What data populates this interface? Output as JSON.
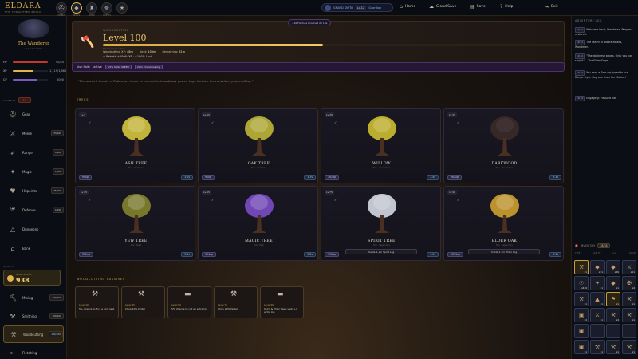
{
  "brand": {
    "logo": "ELDARA",
    "tagline": "THE FORGOTTEN REALM"
  },
  "topbar": {
    "icons": [
      {
        "label": "COMBAT",
        "icon": "helmet-icon"
      },
      {
        "label": "SKILLS",
        "icon": "gem-icon"
      },
      {
        "label": "SHOP",
        "icon": "castle-icon"
      },
      {
        "label": "QUESTS",
        "icon": "mask-icon"
      },
      {
        "label": "",
        "icon": "star-icon"
      }
    ],
    "grandsmith": {
      "name": "GRAND SMITH",
      "level": "Lv.12",
      "tier": "Guardian"
    },
    "nav": [
      {
        "label": "Home",
        "icon": "home-icon"
      },
      {
        "label": "Cloud Save",
        "icon": "cloud-icon"
      },
      {
        "label": "Save",
        "icon": "save-icon"
      },
      {
        "label": "Help",
        "icon": "help-icon"
      },
      {
        "label": "Exit",
        "icon": "exit-icon"
      }
    ]
  },
  "character": {
    "name": "The Wanderer",
    "title_tag": "Lv.14",
    "title": "Guardian",
    "stats": [
      {
        "key": "HP",
        "value": "40/40",
        "fill": 1.0,
        "color": "#c0392b"
      },
      {
        "key": "XP",
        "value": "1,119/1,860",
        "fill": 0.6,
        "color": "#e3b34c"
      },
      {
        "key": "CP",
        "value": "2000",
        "fill": 0.7,
        "color": "#7a5ac0"
      }
    ]
  },
  "combat": {
    "header": "COMBAT",
    "level": "13",
    "skills": [
      {
        "name": "Gear",
        "badge": "",
        "icon": "helmet-icon"
      },
      {
        "name": "Melee",
        "badge": "33/100",
        "icon": "swords-icon"
      },
      {
        "name": "Range",
        "badge": "1/100",
        "icon": "bow-icon"
      },
      {
        "name": "Magic",
        "badge": "1/100",
        "icon": "magic-icon"
      },
      {
        "name": "Hitpoints",
        "badge": "25/100",
        "icon": "heart-icon"
      },
      {
        "name": "Defence",
        "badge": "1/100",
        "icon": "shield-icon"
      },
      {
        "name": "Dungeons",
        "badge": "",
        "icon": "dungeon-icon"
      },
      {
        "name": "Bank",
        "badge": "",
        "icon": "bank-icon"
      }
    ]
  },
  "gold": {
    "label": "GOLD POUCH",
    "value": "938"
  },
  "gather": {
    "header": "SKILLS",
    "skills": [
      {
        "name": "Mining",
        "badge": "100/100",
        "icon": "pickaxe-icon"
      },
      {
        "name": "Smithing",
        "badge": "100/100",
        "icon": "hammer-icon"
      },
      {
        "name": "Woodcutting",
        "badge": "100/100",
        "icon": "axe-icon",
        "selected": true
      },
      {
        "name": "Fletching",
        "badge": "",
        "icon": "arrow-icon"
      }
    ]
  },
  "skill": {
    "category": "WOODCUTTING",
    "level_text": "Level 100",
    "xp_fill": 0.48,
    "xp_note": "Max level reached",
    "xp_line": [
      {
        "k": "Woodcutting XP:",
        "v": "48m"
      },
      {
        "k": "Next:",
        "v": "100m"
      },
      {
        "k": "Remaining:",
        "v": "51m"
      }
    ],
    "bonus": "♦ Rebirth +100% XP · +100% Luck",
    "effect_pill": "+100%  Yoga Crowned    2h 13s",
    "boost_name": "Ash Saltc",
    "boost_state": "active",
    "boost_tag": "+5% SKILL SPEED",
    "boost_time": "29m 37s remaining"
  },
  "lore": "\"The ancient forests of Eldara are home to trees of extraordinary power. Logs fuel our fires and feed your crafting.\"",
  "trees_header": "TREES",
  "trees": [
    {
      "level": "Lv.1",
      "name": "ASH TREE",
      "sub": "Tier · Common",
      "xp": "90xp",
      "time": "3.1s",
      "color": "#e0d040"
    },
    {
      "level": "Lv.15",
      "name": "OAK TREE",
      "sub": "Tier · Common",
      "xp": "90xp",
      "time": "3.3s",
      "color": "#c8c03a"
    },
    {
      "level": "Lv.30",
      "name": "WILLOW",
      "sub": "Tier · Uncommon",
      "xp": "162xp",
      "time": "3.4s",
      "color": "#d8c830"
    },
    {
      "level": "Lv.35",
      "name": "DARKWOOD",
      "sub": "Tier · Uncommon",
      "xp": "262xp",
      "time": "3.3s",
      "color": "#3a2a28"
    },
    {
      "level": "Lv.45",
      "name": "YEW TREE",
      "sub": "Tier · Rare",
      "xp": "332xp",
      "time": "3.8s",
      "color": "#8a8a30"
    },
    {
      "level": "Lv.55",
      "name": "MAGIC TREE",
      "sub": "Tier · Epic",
      "xp": "394xp",
      "time": "3.8s",
      "color": "#8050d0"
    },
    {
      "level": "Lv.75",
      "name": "SPIRIT TREE",
      "sub": "Tier · Legendary",
      "xp": "996xp",
      "time": "1.3s",
      "color": "#dfe4f0",
      "yield": "Yields 1–2× Spirit Log"
    },
    {
      "level": "Lv.90",
      "name": "ELDER OAK",
      "sub": "Tier · Legendary",
      "xp": "1561xp",
      "time": "3.3s",
      "color": "#d8a830",
      "yield": "Yields 1–2× Elder Log"
    }
  ],
  "passives_header": "WOODCUTTING PASSIVES",
  "passives": [
    {
      "level": "Level 10",
      "text": "5% chance to find a bird nest",
      "icon": "axe-icon"
    },
    {
      "level": "Level 25",
      "text": "Chop 10% faster",
      "icon": "axe-icon"
    },
    {
      "level": "Level 50",
      "text": "5% chance to cut an extra log",
      "icon": "log-icon"
    },
    {
      "level": "Level 75",
      "text": "Chop 20% faster",
      "icon": "axe-icon"
    },
    {
      "level": "Level 99",
      "text": "Spirit & Elder trees yield +1 extra log",
      "icon": "log-icon"
    }
  ],
  "log_header": "ADVENTURE LOG",
  "log": [
    {
      "tag": "10:11",
      "text": "Welcome back, Wanderer! Progress restored."
    },
    {
      "tag": "10:11",
      "text": "The realm of Eldara awaits, Wanderer."
    },
    {
      "tag": "10:12",
      "text": "\"The darkness grows. Only you can stop it.\" - The Elder Sage"
    },
    {
      "tag": "10:14",
      "text": "You read a Bow equipped to use Range style. Buy one from the Market!"
    },
    {
      "tag": "10:14",
      "text": "Engaging: Plagued Rat"
    }
  ],
  "inventory": {
    "label": "INVENTORY",
    "count": "28/28",
    "tabs": [
      "TYPE",
      "RARITY",
      "A-Z",
      "VALUE"
    ],
    "slots": [
      {
        "icon": "⚒",
        "qty": "x1",
        "hl": true
      },
      {
        "icon": "◆",
        "qty": "x11",
        "hl": false
      },
      {
        "icon": "◆",
        "qty": "x26",
        "hl": false
      },
      {
        "icon": "⚔",
        "qty": "x11",
        "hl": false
      },
      {
        "icon": "☉",
        "qty": "x416",
        "hl": false
      },
      {
        "icon": "✦",
        "qty": "x1",
        "hl": false
      },
      {
        "icon": "◆",
        "qty": "x1",
        "hl": false
      },
      {
        "icon": "✠",
        "qty": "x4",
        "hl": false
      },
      {
        "icon": "⚒",
        "qty": "x1",
        "hl": false
      },
      {
        "icon": "▲",
        "qty": "x1",
        "hl": false
      },
      {
        "icon": "⚑",
        "qty": "x1",
        "hl": true
      },
      {
        "icon": "⚒",
        "qty": "x1",
        "hl": false
      },
      {
        "icon": "▣",
        "qty": "x2",
        "hl": false
      },
      {
        "icon": "⚔",
        "qty": "x1",
        "hl": false
      },
      {
        "icon": "⚒",
        "qty": "x4",
        "hl": false
      },
      {
        "icon": "⚒",
        "qty": "x1",
        "hl": false
      },
      {
        "icon": "▣",
        "qty": "",
        "hl": false
      },
      {
        "icon": "",
        "qty": "",
        "hl": false
      },
      {
        "icon": "",
        "qty": "",
        "hl": false
      },
      {
        "icon": "",
        "qty": "",
        "hl": false
      },
      {
        "icon": "▣",
        "qty": "x1",
        "hl": false
      },
      {
        "icon": "⚒",
        "qty": "x1",
        "hl": false
      },
      {
        "icon": "⚒",
        "qty": "x1",
        "hl": false
      },
      {
        "icon": "⚒",
        "qty": "x1",
        "hl": false
      }
    ]
  }
}
